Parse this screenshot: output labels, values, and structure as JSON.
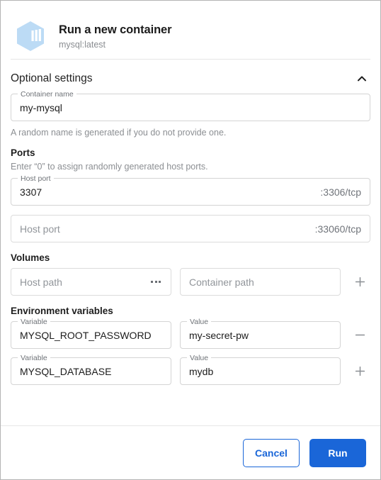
{
  "header": {
    "icon": "container-hexagon-icon",
    "title": "Run a new container",
    "subtitle": "mysql:latest"
  },
  "optional_settings": {
    "title": "Optional settings",
    "toggle_icon": "chevron-up-icon",
    "container_name": {
      "label": "Container name",
      "value": "my-mysql"
    },
    "container_name_hint": "A random name is generated if you do not provide one."
  },
  "ports": {
    "title": "Ports",
    "hint": "Enter “0” to assign randomly generated host ports.",
    "rows": [
      {
        "label": "Host port",
        "value": "3307",
        "placeholder": "Host port",
        "suffix": ":3306/tcp",
        "has_value": true
      },
      {
        "label": "Host port",
        "value": "",
        "placeholder": "Host port",
        "suffix": ":33060/tcp",
        "has_value": false
      }
    ]
  },
  "volumes": {
    "title": "Volumes",
    "host_path": {
      "placeholder": "Host path",
      "value": "",
      "browse_icon": "ellipsis-icon"
    },
    "container_path": {
      "placeholder": "Container path",
      "value": ""
    },
    "action": {
      "icon": "plus-icon",
      "label": "+"
    }
  },
  "environment_variables": {
    "title": "Environment variables",
    "rows": [
      {
        "variable_label": "Variable",
        "variable_value": "MYSQL_ROOT_PASSWORD",
        "value_label": "Value",
        "value_value": "my-secret-pw",
        "action_icon": "minus-icon"
      },
      {
        "variable_label": "Variable",
        "variable_value": "MYSQL_DATABASE",
        "value_label": "Value",
        "value_value": "mydb",
        "action_icon": "plus-icon"
      }
    ]
  },
  "footer": {
    "cancel_label": "Cancel",
    "run_label": "Run"
  },
  "colors": {
    "accent": "#1a66d8",
    "icon_fill": "#bcdbf5",
    "border": "#dcdcdc",
    "text": "#1b1b1b",
    "muted": "#8a8d91"
  }
}
